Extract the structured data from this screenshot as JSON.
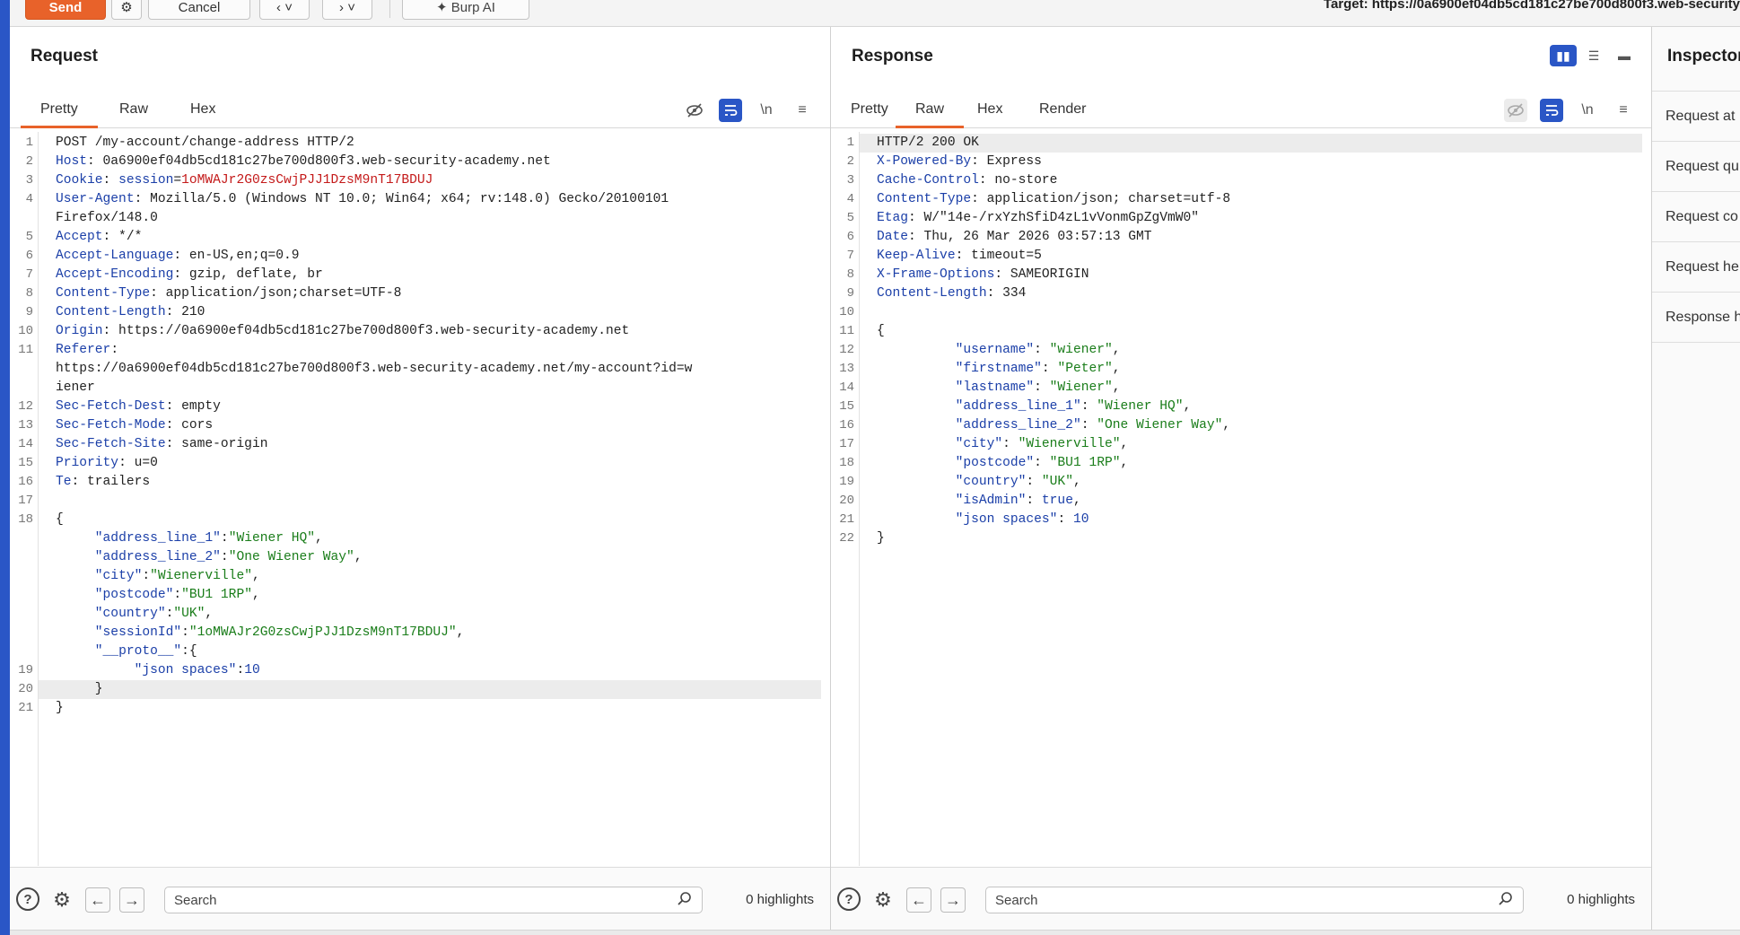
{
  "toolbar": {
    "send": "Send",
    "cancel": "Cancel",
    "back": "‹ ˅",
    "forward": "› ˅",
    "burp_ai": "Burp AI",
    "target": "Target: https://0a6900ef04db5cd181c27be700d800f3.web-security"
  },
  "request": {
    "title": "Request",
    "tabs": [
      "Pretty",
      "Raw",
      "Hex"
    ],
    "active_tab": "Pretty",
    "search_placeholder": "Search",
    "highlights": "0 highlights",
    "lines": [
      {
        "n": "1",
        "parts": [
          [
            "hv",
            "POST /my-account/change-address HTTP/2"
          ]
        ]
      },
      {
        "n": "2",
        "parts": [
          [
            "hk",
            "Host"
          ],
          [
            "hv",
            ": 0a6900ef04db5cd181c27be700d800f3.web-security-academy.net"
          ]
        ]
      },
      {
        "n": "3",
        "parts": [
          [
            "hk",
            "Cookie"
          ],
          [
            "hv",
            ": "
          ],
          [
            "ck",
            "session"
          ],
          [
            "hv",
            "="
          ],
          [
            "cv",
            "1oMWAJr2G0zsCwjPJJ1DzsM9nT17BDUJ"
          ]
        ]
      },
      {
        "n": "4",
        "parts": [
          [
            "hk",
            "User-Agent"
          ],
          [
            "hv",
            ": Mozilla/5.0 (Windows NT 10.0; Win64; x64; rv:148.0) Gecko/20100101"
          ]
        ]
      },
      {
        "n": "",
        "parts": [
          [
            "hv",
            "Firefox/148.0"
          ]
        ]
      },
      {
        "n": "5",
        "parts": [
          [
            "hk",
            "Accept"
          ],
          [
            "hv",
            ": */*"
          ]
        ]
      },
      {
        "n": "6",
        "parts": [
          [
            "hk",
            "Accept-Language"
          ],
          [
            "hv",
            ": en-US,en;q=0.9"
          ]
        ]
      },
      {
        "n": "7",
        "parts": [
          [
            "hk",
            "Accept-Encoding"
          ],
          [
            "hv",
            ": gzip, deflate, br"
          ]
        ]
      },
      {
        "n": "8",
        "parts": [
          [
            "hk",
            "Content-Type"
          ],
          [
            "hv",
            ": application/json;charset=UTF-8"
          ]
        ]
      },
      {
        "n": "9",
        "parts": [
          [
            "hk",
            "Content-Length"
          ],
          [
            "hv",
            ": 210"
          ]
        ]
      },
      {
        "n": "10",
        "parts": [
          [
            "hk",
            "Origin"
          ],
          [
            "hv",
            ": https://0a6900ef04db5cd181c27be700d800f3.web-security-academy.net"
          ]
        ]
      },
      {
        "n": "11",
        "parts": [
          [
            "hk",
            "Referer"
          ],
          [
            "hv",
            ":"
          ]
        ]
      },
      {
        "n": "",
        "parts": [
          [
            "hv",
            "https://0a6900ef04db5cd181c27be700d800f3.web-security-academy.net/my-account?id=w"
          ]
        ]
      },
      {
        "n": "",
        "parts": [
          [
            "hv",
            "iener"
          ]
        ]
      },
      {
        "n": "12",
        "parts": [
          [
            "hk",
            "Sec-Fetch-Dest"
          ],
          [
            "hv",
            ": empty"
          ]
        ]
      },
      {
        "n": "13",
        "parts": [
          [
            "hk",
            "Sec-Fetch-Mode"
          ],
          [
            "hv",
            ": cors"
          ]
        ]
      },
      {
        "n": "14",
        "parts": [
          [
            "hk",
            "Sec-Fetch-Site"
          ],
          [
            "hv",
            ": same-origin"
          ]
        ]
      },
      {
        "n": "15",
        "parts": [
          [
            "hk",
            "Priority"
          ],
          [
            "hv",
            ": u=0"
          ]
        ]
      },
      {
        "n": "16",
        "parts": [
          [
            "hk",
            "Te"
          ],
          [
            "hv",
            ": trailers"
          ]
        ]
      },
      {
        "n": "17",
        "parts": [
          [
            "hv",
            ""
          ]
        ]
      },
      {
        "n": "18",
        "parts": [
          [
            "jp",
            "{"
          ]
        ]
      },
      {
        "n": "",
        "parts": [
          [
            "jp",
            "     "
          ],
          [
            "jk",
            "\"address_line_1\""
          ],
          [
            "jp",
            ":"
          ],
          [
            "js",
            "\"Wiener HQ\""
          ],
          [
            "jp",
            ","
          ]
        ]
      },
      {
        "n": "",
        "parts": [
          [
            "jp",
            "     "
          ],
          [
            "jk",
            "\"address_line_2\""
          ],
          [
            "jp",
            ":"
          ],
          [
            "js",
            "\"One Wiener Way\""
          ],
          [
            "jp",
            ","
          ]
        ]
      },
      {
        "n": "",
        "parts": [
          [
            "jp",
            "     "
          ],
          [
            "jk",
            "\"city\""
          ],
          [
            "jp",
            ":"
          ],
          [
            "js",
            "\"Wienerville\""
          ],
          [
            "jp",
            ","
          ]
        ]
      },
      {
        "n": "",
        "parts": [
          [
            "jp",
            "     "
          ],
          [
            "jk",
            "\"postcode\""
          ],
          [
            "jp",
            ":"
          ],
          [
            "js",
            "\"BU1 1RP\""
          ],
          [
            "jp",
            ","
          ]
        ]
      },
      {
        "n": "",
        "parts": [
          [
            "jp",
            "     "
          ],
          [
            "jk",
            "\"country\""
          ],
          [
            "jp",
            ":"
          ],
          [
            "js",
            "\"UK\""
          ],
          [
            "jp",
            ","
          ]
        ]
      },
      {
        "n": "",
        "parts": [
          [
            "jp",
            "     "
          ],
          [
            "jk",
            "\"sessionId\""
          ],
          [
            "jp",
            ":"
          ],
          [
            "js",
            "\"1oMWAJr2G0zsCwjPJJ1DzsM9nT17BDUJ\""
          ],
          [
            "jp",
            ","
          ]
        ]
      },
      {
        "n": "",
        "parts": [
          [
            "jp",
            "     "
          ],
          [
            "jk",
            "\"__proto__\""
          ],
          [
            "jp",
            ":{"
          ]
        ]
      },
      {
        "n": "19",
        "parts": [
          [
            "jp",
            "          "
          ],
          [
            "jk",
            "\"json spaces\""
          ],
          [
            "jp",
            ":"
          ],
          [
            "jn",
            "10"
          ]
        ]
      },
      {
        "n": "20",
        "parts": [
          [
            "jp",
            "     }"
          ]
        ],
        "hl": true
      },
      {
        "n": "21",
        "parts": [
          [
            "jp",
            "}"
          ]
        ]
      }
    ]
  },
  "response": {
    "title": "Response",
    "tabs": [
      "Pretty",
      "Raw",
      "Hex",
      "Render"
    ],
    "active_tab": "Raw",
    "search_placeholder": "Search",
    "highlights": "0 highlights",
    "lines": [
      {
        "n": "1",
        "parts": [
          [
            "hv",
            "HTTP/2 200 OK"
          ]
        ],
        "hl": true
      },
      {
        "n": "2",
        "parts": [
          [
            "hk",
            "X-Powered-By"
          ],
          [
            "hv",
            ": Express"
          ]
        ]
      },
      {
        "n": "3",
        "parts": [
          [
            "hk",
            "Cache-Control"
          ],
          [
            "hv",
            ": no-store"
          ]
        ]
      },
      {
        "n": "4",
        "parts": [
          [
            "hk",
            "Content-Type"
          ],
          [
            "hv",
            ": application/json; charset=utf-8"
          ]
        ]
      },
      {
        "n": "5",
        "parts": [
          [
            "hk",
            "Etag"
          ],
          [
            "hv",
            ": W/\"14e-/rxYzhSfiD4zL1vVonmGpZgVmW0\""
          ]
        ]
      },
      {
        "n": "6",
        "parts": [
          [
            "hk",
            "Date"
          ],
          [
            "hv",
            ": Thu, 26 Mar 2026 03:57:13 GMT"
          ]
        ]
      },
      {
        "n": "7",
        "parts": [
          [
            "hk",
            "Keep-Alive"
          ],
          [
            "hv",
            ": timeout=5"
          ]
        ]
      },
      {
        "n": "8",
        "parts": [
          [
            "hk",
            "X-Frame-Options"
          ],
          [
            "hv",
            ": SAMEORIGIN"
          ]
        ]
      },
      {
        "n": "9",
        "parts": [
          [
            "hk",
            "Content-Length"
          ],
          [
            "hv",
            ": 334"
          ]
        ]
      },
      {
        "n": "10",
        "parts": [
          [
            "hv",
            ""
          ]
        ]
      },
      {
        "n": "11",
        "parts": [
          [
            "jp",
            "{"
          ]
        ]
      },
      {
        "n": "12",
        "parts": [
          [
            "jp",
            "          "
          ],
          [
            "jk",
            "\"username\""
          ],
          [
            "jp",
            ": "
          ],
          [
            "js",
            "\"wiener\""
          ],
          [
            "jp",
            ","
          ]
        ]
      },
      {
        "n": "13",
        "parts": [
          [
            "jp",
            "          "
          ],
          [
            "jk",
            "\"firstname\""
          ],
          [
            "jp",
            ": "
          ],
          [
            "js",
            "\"Peter\""
          ],
          [
            "jp",
            ","
          ]
        ]
      },
      {
        "n": "14",
        "parts": [
          [
            "jp",
            "          "
          ],
          [
            "jk",
            "\"lastname\""
          ],
          [
            "jp",
            ": "
          ],
          [
            "js",
            "\"Wiener\""
          ],
          [
            "jp",
            ","
          ]
        ]
      },
      {
        "n": "15",
        "parts": [
          [
            "jp",
            "          "
          ],
          [
            "jk",
            "\"address_line_1\""
          ],
          [
            "jp",
            ": "
          ],
          [
            "js",
            "\"Wiener HQ\""
          ],
          [
            "jp",
            ","
          ]
        ]
      },
      {
        "n": "16",
        "parts": [
          [
            "jp",
            "          "
          ],
          [
            "jk",
            "\"address_line_2\""
          ],
          [
            "jp",
            ": "
          ],
          [
            "js",
            "\"One Wiener Way\""
          ],
          [
            "jp",
            ","
          ]
        ]
      },
      {
        "n": "17",
        "parts": [
          [
            "jp",
            "          "
          ],
          [
            "jk",
            "\"city\""
          ],
          [
            "jp",
            ": "
          ],
          [
            "js",
            "\"Wienerville\""
          ],
          [
            "jp",
            ","
          ]
        ]
      },
      {
        "n": "18",
        "parts": [
          [
            "jp",
            "          "
          ],
          [
            "jk",
            "\"postcode\""
          ],
          [
            "jp",
            ": "
          ],
          [
            "js",
            "\"BU1 1RP\""
          ],
          [
            "jp",
            ","
          ]
        ]
      },
      {
        "n": "19",
        "parts": [
          [
            "jp",
            "          "
          ],
          [
            "jk",
            "\"country\""
          ],
          [
            "jp",
            ": "
          ],
          [
            "js",
            "\"UK\""
          ],
          [
            "jp",
            ","
          ]
        ]
      },
      {
        "n": "20",
        "parts": [
          [
            "jp",
            "          "
          ],
          [
            "jk",
            "\"isAdmin\""
          ],
          [
            "jp",
            ": "
          ],
          [
            "jn",
            "true"
          ],
          [
            "jp",
            ","
          ]
        ]
      },
      {
        "n": "21",
        "parts": [
          [
            "jp",
            "          "
          ],
          [
            "jk",
            "\"json spaces\""
          ],
          [
            "jp",
            ": "
          ],
          [
            "jn",
            "10"
          ]
        ]
      },
      {
        "n": "22",
        "parts": [
          [
            "jp",
            "}"
          ]
        ]
      }
    ]
  },
  "inspector": {
    "title": "Inspector",
    "items": [
      "Request at",
      "Request qu",
      "Request co",
      "Request he",
      "Response h"
    ]
  },
  "colors": {
    "accent": "#e8622a",
    "brand_blue": "#2a56c6"
  }
}
